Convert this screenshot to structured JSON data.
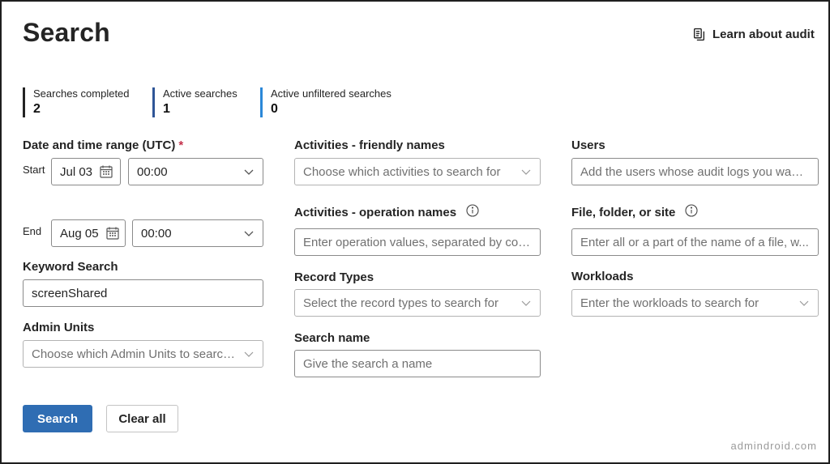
{
  "header": {
    "title": "Search",
    "learn_link": "Learn about audit",
    "learn_icon": "copy-pages-icon"
  },
  "stats": [
    {
      "label": "Searches completed",
      "value": "2",
      "color": "#242424"
    },
    {
      "label": "Active searches",
      "value": "1",
      "color": "#2f5597"
    },
    {
      "label": "Active unfiltered searches",
      "value": "0",
      "color": "#2b88d8"
    }
  ],
  "date_range": {
    "label": "Date and time range (UTC)",
    "required_mark": "*",
    "start_label": "Start",
    "start_date": "Jul 03",
    "start_time": "00:00",
    "end_label": "End",
    "end_date": "Aug 05",
    "end_time": "00:00"
  },
  "keyword": {
    "label": "Keyword Search",
    "value": "screenShared"
  },
  "admin_units": {
    "label": "Admin Units",
    "placeholder": "Choose which Admin Units to search ..."
  },
  "activities_friendly": {
    "label": "Activities - friendly names",
    "placeholder": "Choose which activities to search for"
  },
  "activities_operation": {
    "label": "Activities - operation names",
    "placeholder": "Enter operation values, separated by com..."
  },
  "record_types": {
    "label": "Record Types",
    "placeholder": "Select the record types to search for"
  },
  "search_name": {
    "label": "Search name",
    "placeholder": "Give the search a name"
  },
  "users": {
    "label": "Users",
    "placeholder": "Add the users whose audit logs you want ..."
  },
  "file_folder": {
    "label": "File, folder, or site",
    "placeholder": "Enter all or a part of the name of a file, w..."
  },
  "workloads": {
    "label": "Workloads",
    "placeholder": "Enter the workloads to search for"
  },
  "actions": {
    "search_label": "Search",
    "clear_label": "Clear all"
  },
  "watermark": "admindroid.com",
  "colors": {
    "primary": "#2f6db3",
    "required": "#c4314b"
  }
}
